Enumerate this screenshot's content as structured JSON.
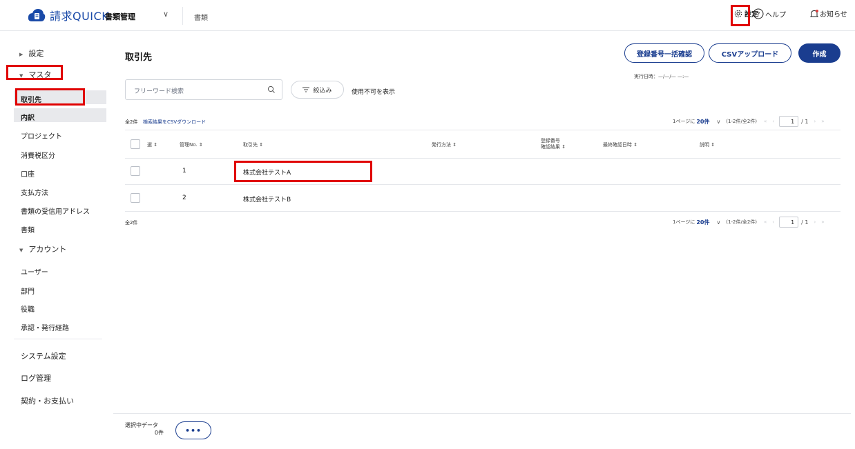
{
  "header": {
    "app_name": "請求QUICK",
    "menu_label": "書類管理",
    "menu_chevron": "∨",
    "sub_label": "書類",
    "settings": "設定",
    "help": "ヘルプ",
    "notice": "お知らせ",
    "logo_icon": "cloud-document-icon",
    "brand_color": "#1a4aa8"
  },
  "sidebar": {
    "settings": "設定",
    "master": "マスタ",
    "items": [
      "取引先",
      "内訳",
      "プロジェクト",
      "消費税区分",
      "口座",
      "支払方法",
      "書類の受信用アドレス",
      "書類"
    ],
    "account": "アカウント",
    "account_items": [
      "ユーザー",
      "部門",
      "役職",
      "承認・発行経路"
    ],
    "bottom_items": [
      "システム設定",
      "ログ管理",
      "契約・お支払い"
    ]
  },
  "page": {
    "title": "取引先",
    "bulk_check_btn": "登録番号一括確認",
    "csv_upload_btn": "CSVアップロード",
    "create_btn": "作成",
    "exec_date": "実行日時：—/—/— —:—",
    "search_placeholder": "フリーワード検索",
    "filter_btn": "絞込み",
    "show_disabled": "使用不可を表示",
    "count_top": "全2件",
    "csv_download_link": "検索結果をCSVダウンロード",
    "count_bottom": "全2件"
  },
  "pager": {
    "per_page_prefix": "1ページに",
    "per_page": "20件",
    "range": "(1-2件/全2件)",
    "first": "«",
    "prev": "‹",
    "page": "1",
    "total": "/ 1",
    "next": "›",
    "last": "»"
  },
  "table": {
    "headers": {
      "sel": "選",
      "id": "管理No.",
      "partner": "取引先",
      "issue": "発行方法",
      "regno_line1": "登録番号",
      "regno_line2": "確認結果",
      "lastcheck": "最終確認日時",
      "desc": "説明"
    },
    "sort_icon": "⇕",
    "rows": [
      {
        "id": "1",
        "partner": "株式会社テストA"
      },
      {
        "id": "2",
        "partner": "株式会社テストB"
      }
    ]
  },
  "footer": {
    "selected_label": "選択中データ",
    "selected_count": "0件",
    "more_btn": "•••"
  }
}
